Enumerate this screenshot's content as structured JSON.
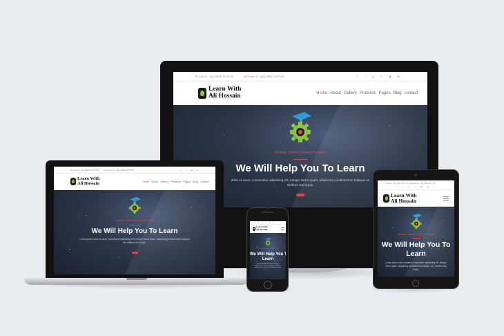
{
  "site": {
    "call_text": "Call Us : (62) 0896 1576718",
    "email_text": "Email Us : (62) 0896 1576718",
    "logo_line1": "Learn With",
    "logo_line2": "Ali Hossain",
    "menu": [
      "Home",
      "About",
      "Gallery",
      "Products",
      "Pages",
      "Blog",
      "contact"
    ],
    "active_menu": "Home",
    "social_icons": [
      "facebook-icon",
      "twitter-icon",
      "google-plus-icon",
      "linkedin-icon",
      "instagram-icon",
      "rss-icon"
    ],
    "subtitle": "Creative, Online Courses Template",
    "headline": "We Will Help You To Learn",
    "headline_line1": "We Will Help You To",
    "headline_line2": "Learn",
    "lorem": "Lorem ipsum dolor sit amet, consectetur adipiscing elit, Integer lorem quam, adipiscing condimentum tristique vel, eleifend sed turpis.",
    "lorem_partial": "dolor sit amet, consectetur adipiscing elit, Integer lorem quam, adipiscing condimentum tristique ve",
    "lorem_partial2": "eleifend sed turpis."
  },
  "colors": {
    "accent": "#e24a4a",
    "logo_green": "#8cc63f",
    "cap_blue": "#2a9fd6",
    "hero_dark": "#2c3648"
  }
}
